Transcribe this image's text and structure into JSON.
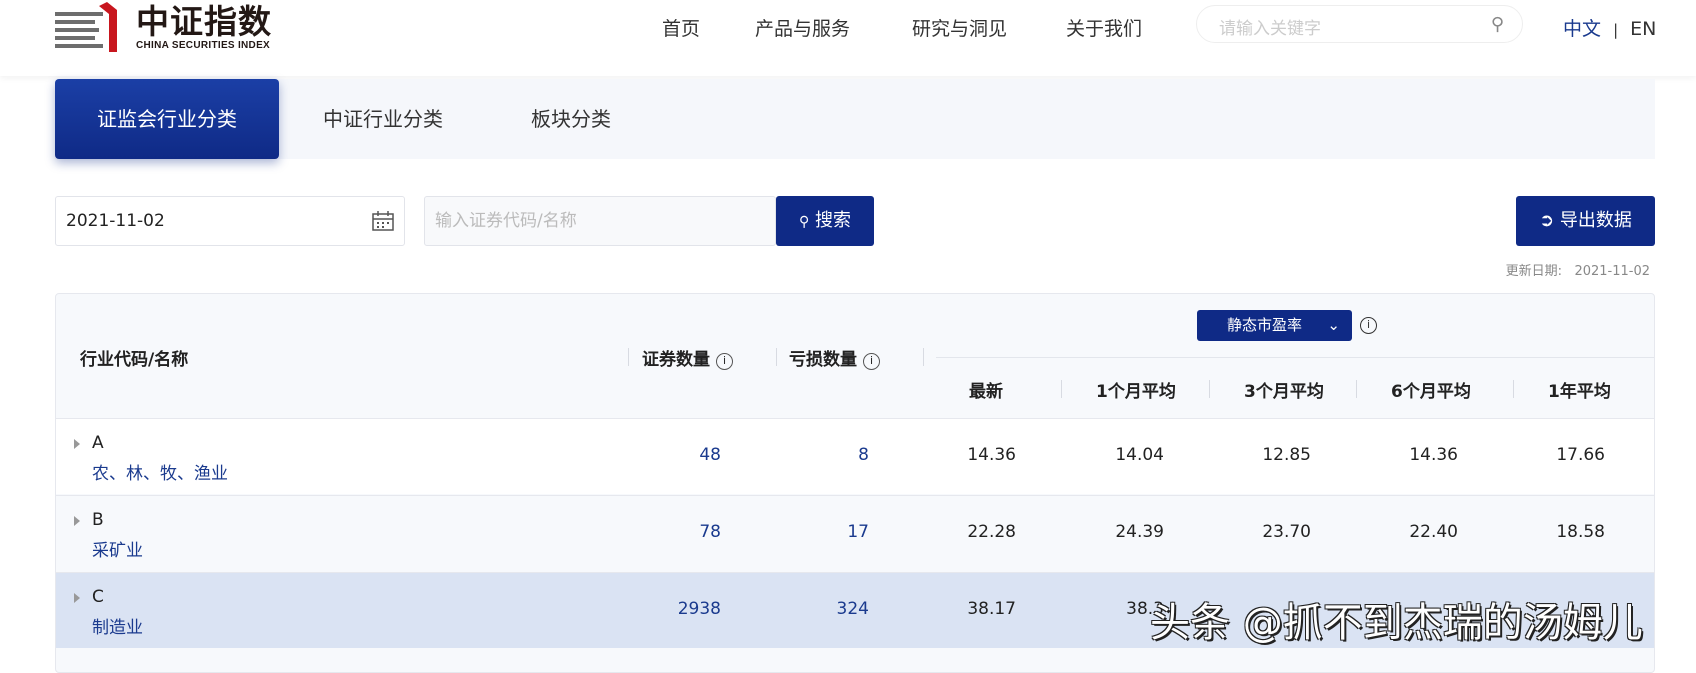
{
  "header": {
    "logo_cn": "中证指数",
    "logo_en": "CHINA SECURITIES INDEX",
    "nav": [
      "首页",
      "产品与服务",
      "研究与洞见",
      "关于我们"
    ],
    "search_placeholder": "请输入关键字",
    "lang_zh": "中文",
    "lang_sep": "|",
    "lang_en": "EN"
  },
  "tabs": [
    "证监会行业分类",
    "中证行业分类",
    "板块分类"
  ],
  "filters": {
    "date": "2021-11-02",
    "code_placeholder": "输入证券代码/名称",
    "search_label": "搜索",
    "export_label": "导出数据",
    "update_label": "更新日期:",
    "update_date": "2021-11-02"
  },
  "table": {
    "col_name": "行业代码/名称",
    "col_count": "证券数量",
    "col_loss": "亏损数量",
    "metric_select": "静态市盈率",
    "sub_cols": [
      "最新",
      "1个月平均",
      "3个月平均",
      "6个月平均",
      "1年平均"
    ],
    "rows": [
      {
        "code": "A",
        "name": "农、林、牧、渔业",
        "count": "48",
        "loss": "8",
        "vals": [
          "14.36",
          "14.04",
          "12.85",
          "14.36",
          "17.66"
        ]
      },
      {
        "code": "B",
        "name": "采矿业",
        "count": "78",
        "loss": "17",
        "vals": [
          "22.28",
          "24.39",
          "23.70",
          "22.40",
          "18.58"
        ]
      },
      {
        "code": "C",
        "name": "制造业",
        "count": "2938",
        "loss": "324",
        "vals": [
          "38.17",
          "38.3",
          "",
          "",
          ""
        ]
      }
    ]
  },
  "watermark": "头条 @抓不到杰瑞的汤姆儿"
}
